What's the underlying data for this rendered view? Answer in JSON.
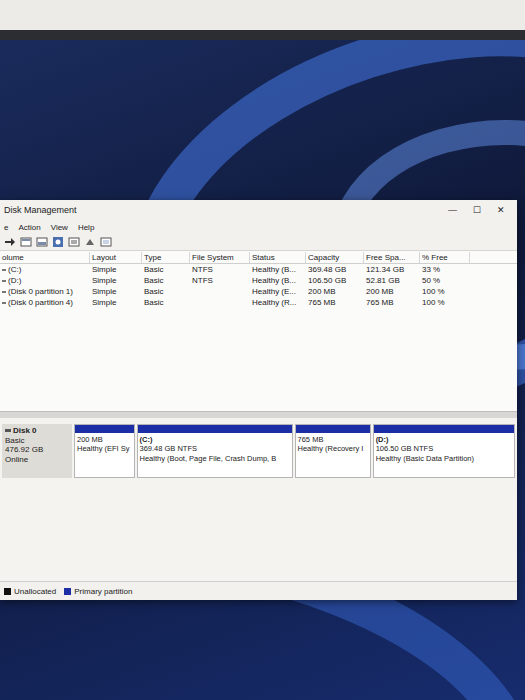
{
  "window": {
    "title": "Disk Management",
    "controls": [
      "—",
      "☐",
      "✕"
    ]
  },
  "menu": [
    "e",
    "Action",
    "View",
    "Help"
  ],
  "table": {
    "columns": [
      "olume",
      "Layout",
      "Type",
      "File System",
      "Status",
      "Capacity",
      "Free Spa...",
      "% Free"
    ],
    "rows": [
      {
        "cells": [
          "(C:)",
          "Simple",
          "Basic",
          "NTFS",
          "Healthy (B...",
          "369.48 GB",
          "121.34 GB",
          "33 %"
        ]
      },
      {
        "cells": [
          "(D:)",
          "Simple",
          "Basic",
          "NTFS",
          "Healthy (B...",
          "106.50 GB",
          "52.81 GB",
          "50 %"
        ]
      },
      {
        "cells": [
          "(Disk 0 partition 1)",
          "Simple",
          "Basic",
          "",
          "Healthy (E...",
          "200 MB",
          "200 MB",
          "100 %"
        ]
      },
      {
        "cells": [
          "(Disk 0 partition 4)",
          "Simple",
          "Basic",
          "",
          "Healthy (R...",
          "765 MB",
          "765 MB",
          "100 %"
        ]
      }
    ]
  },
  "disks": [
    {
      "name": "Disk 0",
      "type": "Basic",
      "size": "476.92 GB",
      "status": "Online",
      "partitions": [
        {
          "size": "200 MB",
          "status": "Healthy (EFI Sy"
        },
        {
          "name": "(C:)",
          "size": "369.48 GB NTFS",
          "status": "Healthy (Boot, Page File, Crash Dump, B"
        },
        {
          "size": "765 MB",
          "status": "Healthy (Recovery I"
        },
        {
          "name": "(D:)",
          "size": "106.50 GB NTFS",
          "status": "Healthy (Basic Data Partition)"
        }
      ]
    }
  ],
  "legend": [
    {
      "label": "Unallocated",
      "color": "#111111"
    },
    {
      "label": "Primary partition",
      "color": "#1c2ea6"
    }
  ]
}
